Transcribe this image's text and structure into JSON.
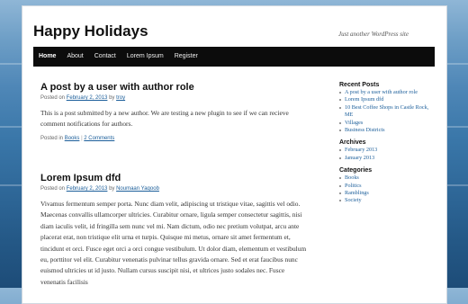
{
  "site": {
    "title": "Happy Holidays",
    "tagline": "Just another WordPress site"
  },
  "nav": [
    "Home",
    "About",
    "Contact",
    "Lorem Ipsum",
    "Register"
  ],
  "posts": [
    {
      "title": "A post by a user with author role",
      "meta_prefix": "Posted on",
      "date": "February 2, 2013",
      "by": "by",
      "author": "troy",
      "body": "This is a post submitted by a new author. We are testing a new plugin to see if we can recieve comment notifications for authors.",
      "footer_prefix": "Posted in",
      "category": "Books",
      "sep": "|",
      "comments": "2 Comments"
    },
    {
      "title": "Lorem Ipsum dfd",
      "meta_prefix": "Posted on",
      "date": "February 2, 2013",
      "by": "by",
      "author": "Noumaan Yaqoob",
      "body": "Vivamus fermentum semper porta. Nunc diam velit, adipiscing ut tristique vitae, sagittis vel odio. Maecenas convallis ullamcorper ultricies. Curabitur ornare, ligula semper consectetur sagittis, nisi diam iaculis velit, id fringilla sem nunc vel mi. Nam dictum, odio nec pretium volutpat, arcu ante placerat erat, non tristique elit urna et turpis. Quisque mi metus, ornare sit amet fermentum et, tincidunt et orci. Fusce eget orci a orci congue vestibulum. Ut dolor diam, elementum et vestibulum eu, porttitor vel elit. Curabitur venenatis pulvinar tellus gravida ornare. Sed et erat faucibus nunc euismod ultricies ut id justo. Nullam cursus suscipit nisi, et ultrices justo sodales nec. Fusce venenatis facilisis"
    }
  ],
  "sidebar": {
    "recent_title": "Recent Posts",
    "recent": [
      "A post by a user with author role",
      "Lorem Ipsum dfd",
      "10 Best Coffee Shops in Castle Rock, ME",
      "Villages",
      "Business Districts"
    ],
    "archives_title": "Archives",
    "archives": [
      "February 2013",
      "January 2013"
    ],
    "categories_title": "Categories",
    "categories": [
      "Books",
      "Politics",
      "Ramblings",
      "Society"
    ]
  }
}
